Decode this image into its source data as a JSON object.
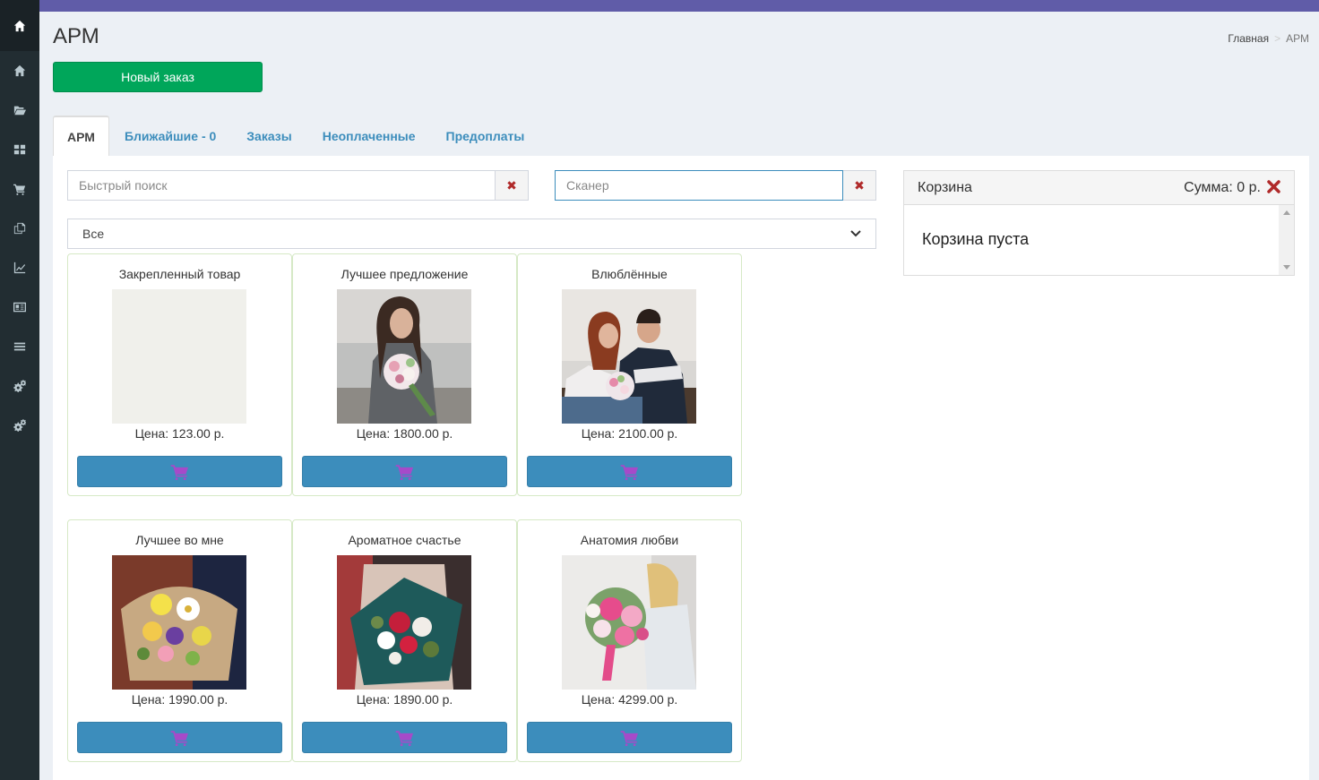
{
  "header": {
    "title": "АРМ",
    "breadcrumb": {
      "home": "Главная",
      "separator": ">",
      "current": "АРМ"
    }
  },
  "actions": {
    "new_order": "Новый заказ"
  },
  "tabs": [
    {
      "label": "АРМ",
      "active": true
    },
    {
      "label": "Ближайшие - 0"
    },
    {
      "label": "Заказы"
    },
    {
      "label": "Неоплаченные"
    },
    {
      "label": "Предоплаты"
    }
  ],
  "search": {
    "quick_placeholder": "Быстрый поиск",
    "scanner_placeholder": "Сканер",
    "clear_glyph": "✖"
  },
  "filter": {
    "selected": "Все"
  },
  "products": [
    {
      "name": "Закрепленный товар",
      "price": "Цена: 123.00 р.",
      "image": "blank"
    },
    {
      "name": "Лучшее предложение",
      "price": "Цена: 1800.00 р.",
      "image": "woman-with-bouquet"
    },
    {
      "name": "Влюблённые",
      "price": "Цена: 2100.00 р.",
      "image": "couple-with-flowers"
    },
    {
      "name": "Лучшее во мне",
      "price": "Цена: 1990.00 р.",
      "image": "yellow-bouquet"
    },
    {
      "name": "Ароматное счастье",
      "price": "Цена: 1890.00 р.",
      "image": "red-white-bouquet"
    },
    {
      "name": "Анатомия любви",
      "price": "Цена: 4299.00 р.",
      "image": "pink-peony-bouquet"
    }
  ],
  "cart": {
    "title": "Корзина",
    "sum_label": "Сумма: 0 р.",
    "empty_text": "Корзина пуста"
  },
  "sidebar": {
    "icons": [
      "home-icon",
      "home-icon",
      "folder-open-icon",
      "dashboard-icon",
      "shopping-cart-icon",
      "copy-icon",
      "line-chart-icon",
      "id-card-icon",
      "list-icon",
      "cogs-icon",
      "cogs-icon"
    ]
  },
  "colors": {
    "accent": "#605ca8",
    "success": "#00a65a",
    "primary": "#3c8dbc",
    "sidebar": "#222d32",
    "danger": "#b02a2a"
  }
}
